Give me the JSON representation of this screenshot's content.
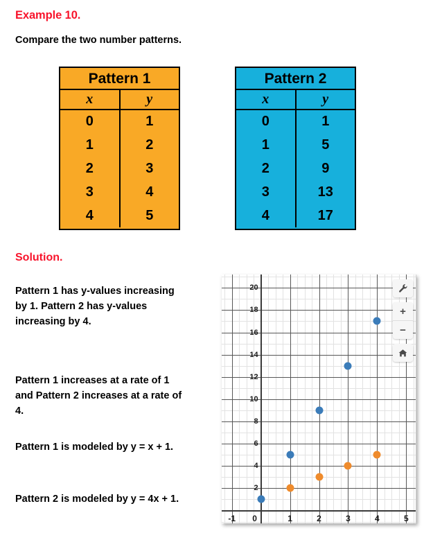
{
  "example_title": "Example 10.",
  "prompt": "Compare the two number patterns.",
  "solution_title": "Solution.",
  "colors": {
    "accent_red": "#f8142c",
    "pattern1_fill": "#F9A926",
    "pattern2_fill": "#17B0DC",
    "series_blue": "#3b7cb9",
    "series_orange": "#ef8b2c"
  },
  "tables": [
    {
      "title": "Pattern 1",
      "columns": [
        "x",
        "y"
      ],
      "x": [
        "0",
        "1",
        "2",
        "3",
        "4"
      ],
      "y": [
        "1",
        "2",
        "3",
        "4",
        "5"
      ]
    },
    {
      "title": "Pattern 2",
      "columns": [
        "x",
        "y"
      ],
      "x": [
        "0",
        "1",
        "2",
        "3",
        "4"
      ],
      "y": [
        "1",
        "5",
        "9",
        "13",
        "17"
      ]
    }
  ],
  "solution_paragraphs": [
    "Pattern 1 has y-values increasing by 1. Pattern 2 has y-values increasing by 4.",
    "Pattern 1 increases at a rate of 1 and Pattern 2 increases at a rate of 4.",
    "Pattern 1 is modeled by y = x + 1.",
    "Pattern 2 is modeled by y = 4x + 1."
  ],
  "graph_toolbar": [
    {
      "name": "settings-wrench-button",
      "label": ""
    },
    {
      "name": "zoom-in-button",
      "label": "+"
    },
    {
      "name": "zoom-out-button",
      "label": "−"
    },
    {
      "name": "home-button",
      "label": ""
    }
  ],
  "chart_data": {
    "type": "scatter",
    "title": "",
    "xlabel": "",
    "ylabel": "",
    "xlim": [
      -1.35,
      5.35
    ],
    "ylim": [
      -1.15,
      21.2
    ],
    "xticks": [
      -1,
      0,
      1,
      2,
      3,
      4,
      5
    ],
    "yticks": [
      0,
      2,
      4,
      6,
      8,
      10,
      12,
      14,
      16,
      18,
      20
    ],
    "xtick_labels": [
      "-1",
      "0",
      "1",
      "2",
      "3",
      "4",
      "5"
    ],
    "ytick_labels": [
      "0",
      "2",
      "4",
      "6",
      "8",
      "10",
      "12",
      "14",
      "16",
      "18",
      "20"
    ],
    "grid": true,
    "minor_grid": true,
    "legend": "none",
    "series": [
      {
        "name": "Pattern 2",
        "color": "#3b7cb9",
        "points": [
          {
            "x": 0,
            "y": 1
          },
          {
            "x": 1,
            "y": 5
          },
          {
            "x": 2,
            "y": 9
          },
          {
            "x": 3,
            "y": 13
          },
          {
            "x": 4,
            "y": 17
          }
        ]
      },
      {
        "name": "Pattern 1",
        "color": "#ef8b2c",
        "points": [
          {
            "x": 1,
            "y": 2
          },
          {
            "x": 2,
            "y": 3
          },
          {
            "x": 3,
            "y": 4
          },
          {
            "x": 4,
            "y": 5
          }
        ]
      }
    ]
  }
}
